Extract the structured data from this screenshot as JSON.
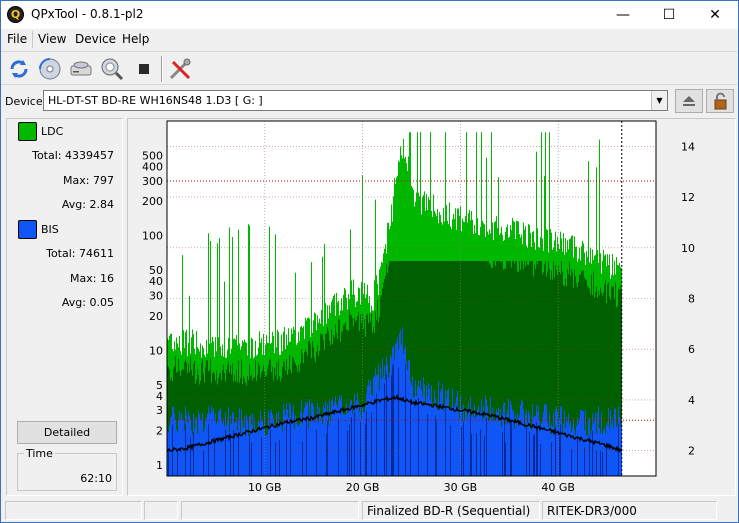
{
  "window": {
    "title": "QPxTool - 0.8.1-pl2",
    "minimize": "—",
    "maximize": "☐",
    "close": "✕"
  },
  "menu": [
    "File",
    "View",
    "Device",
    "Help"
  ],
  "toolbar": [
    "refresh-icon",
    "disc-scan-icon",
    "drive-icon",
    "magnify-disc-icon",
    "stop-icon",
    "tools-icon"
  ],
  "device": {
    "label": "Device:",
    "value": "HL-DT-ST BD-RE  WH16NS48  1.D3 [ G: ]"
  },
  "stats": {
    "ldc": {
      "name": "LDC",
      "color": "#00b800",
      "total_label": "Total:",
      "total": "4339457",
      "max_label": "Max:",
      "max": "797",
      "avg_label": "Avg:",
      "avg": "2.84"
    },
    "bis": {
      "name": "BIS",
      "color": "#1055f5",
      "total_label": "Total:",
      "total": "74611",
      "max_label": "Max:",
      "max": "16",
      "avg_label": "Avg:",
      "avg": "0.05"
    }
  },
  "detailed_button": "Detailed",
  "time": {
    "label": "Time",
    "value": "62:10"
  },
  "chart_data": {
    "type": "bar",
    "title": "",
    "y_left_ticks": [
      "1",
      "2",
      "3",
      "4",
      "5",
      "10",
      "20",
      "30",
      "40",
      "50",
      "100",
      "200",
      "300",
      "400",
      "500"
    ],
    "y_left_scale": "log",
    "y_left_range": [
      0.8,
      1000
    ],
    "y_right_ticks": [
      "2",
      "4",
      "6",
      "8",
      "10",
      "12",
      "14"
    ],
    "y_right_range": [
      1,
      15
    ],
    "x_ticks": [
      "10 GB",
      "20 GB",
      "30 GB",
      "40 GB"
    ],
    "x_tick_values": [
      10,
      20,
      30,
      40
    ],
    "x_range": [
      0,
      50
    ],
    "data_end_gb": 46.5,
    "reference_lines_left": [
      300
    ],
    "reference_lines_right": [
      3.2
    ],
    "series": [
      {
        "name": "LDC",
        "color": "#00b800",
        "dark_color": "#006000",
        "x": [
          0,
          5,
          10,
          13,
          16,
          19,
          21,
          22,
          23,
          24,
          25,
          26,
          28,
          30,
          32,
          35,
          38,
          41,
          44,
          46.5
        ],
        "y": [
          15,
          14,
          14,
          16,
          25,
          40,
          35,
          60,
          200,
          797,
          300,
          250,
          200,
          180,
          150,
          140,
          120,
          100,
          80,
          60
        ]
      },
      {
        "name": "BIS",
        "color": "#1055f5",
        "dark_color": "#002a9a",
        "x": [
          0,
          10,
          20,
          23,
          24,
          25,
          30,
          40,
          46.5
        ],
        "y": [
          3,
          3,
          4,
          10,
          16,
          6,
          4,
          3,
          3
        ]
      },
      {
        "name": "Speed",
        "color": "#000000",
        "x": [
          0,
          2,
          5,
          8,
          10,
          12,
          15,
          18,
          20,
          22,
          23.5,
          25,
          27,
          30,
          33,
          36,
          39,
          42,
          45,
          46.5
        ],
        "y": [
          2.0,
          2.1,
          2.4,
          2.7,
          2.9,
          3.1,
          3.3,
          3.6,
          3.8,
          4.0,
          4.1,
          3.9,
          3.8,
          3.6,
          3.4,
          3.1,
          2.8,
          2.5,
          2.2,
          2.0
        ]
      }
    ]
  },
  "statusbar": {
    "finalized": "Finalized BD-R (Sequential)",
    "media": "RITEK-DR3/000"
  }
}
